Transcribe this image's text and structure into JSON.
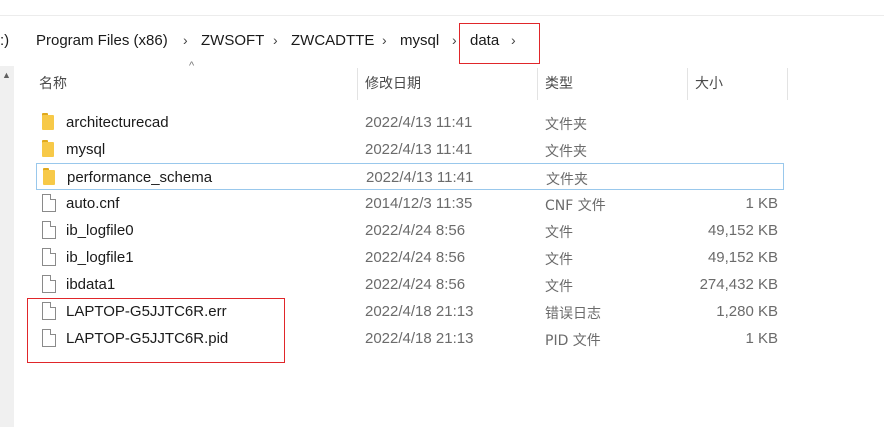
{
  "breadcrumb": {
    "items": [
      ":)",
      "Program Files (x86)",
      "ZWSOFT",
      "ZWCADTTE",
      "mysql",
      "data"
    ]
  },
  "columns": {
    "name": "名称",
    "date": "修改日期",
    "type": "类型",
    "size": "大小"
  },
  "files": [
    {
      "name": "architecturecad",
      "date": "2022/4/13 11:41",
      "type": "文件夹",
      "size": "",
      "icon": "folder-icon"
    },
    {
      "name": "mysql",
      "date": "2022/4/13 11:41",
      "type": "文件夹",
      "size": "",
      "icon": "folder-icon"
    },
    {
      "name": "performance_schema",
      "date": "2022/4/13 11:41",
      "type": "文件夹",
      "size": "",
      "icon": "folder-icon"
    },
    {
      "name": "auto.cnf",
      "date": "2014/12/3 11:35",
      "type": "CNF 文件",
      "size": "1 KB",
      "icon": "file-icon"
    },
    {
      "name": "ib_logfile0",
      "date": "2022/4/24 8:56",
      "type": "文件",
      "size": "49,152 KB",
      "icon": "file-icon"
    },
    {
      "name": "ib_logfile1",
      "date": "2022/4/24 8:56",
      "type": "文件",
      "size": "49,152 KB",
      "icon": "file-icon"
    },
    {
      "name": "ibdata1",
      "date": "2022/4/24 8:56",
      "type": "文件",
      "size": "274,432 KB",
      "icon": "file-icon"
    },
    {
      "name": "LAPTOP-G5JJTC6R.err",
      "date": "2022/4/18 21:13",
      "type": "错误日志",
      "size": "1,280 KB",
      "icon": "file-icon"
    },
    {
      "name": "LAPTOP-G5JJTC6R.pid",
      "date": "2022/4/18 21:13",
      "type": "PID 文件",
      "size": "1 KB",
      "icon": "file-icon"
    }
  ],
  "colors": {
    "highlight": "#e0262a",
    "focus_border": "#99c8ec",
    "folder": "#f7c948"
  }
}
